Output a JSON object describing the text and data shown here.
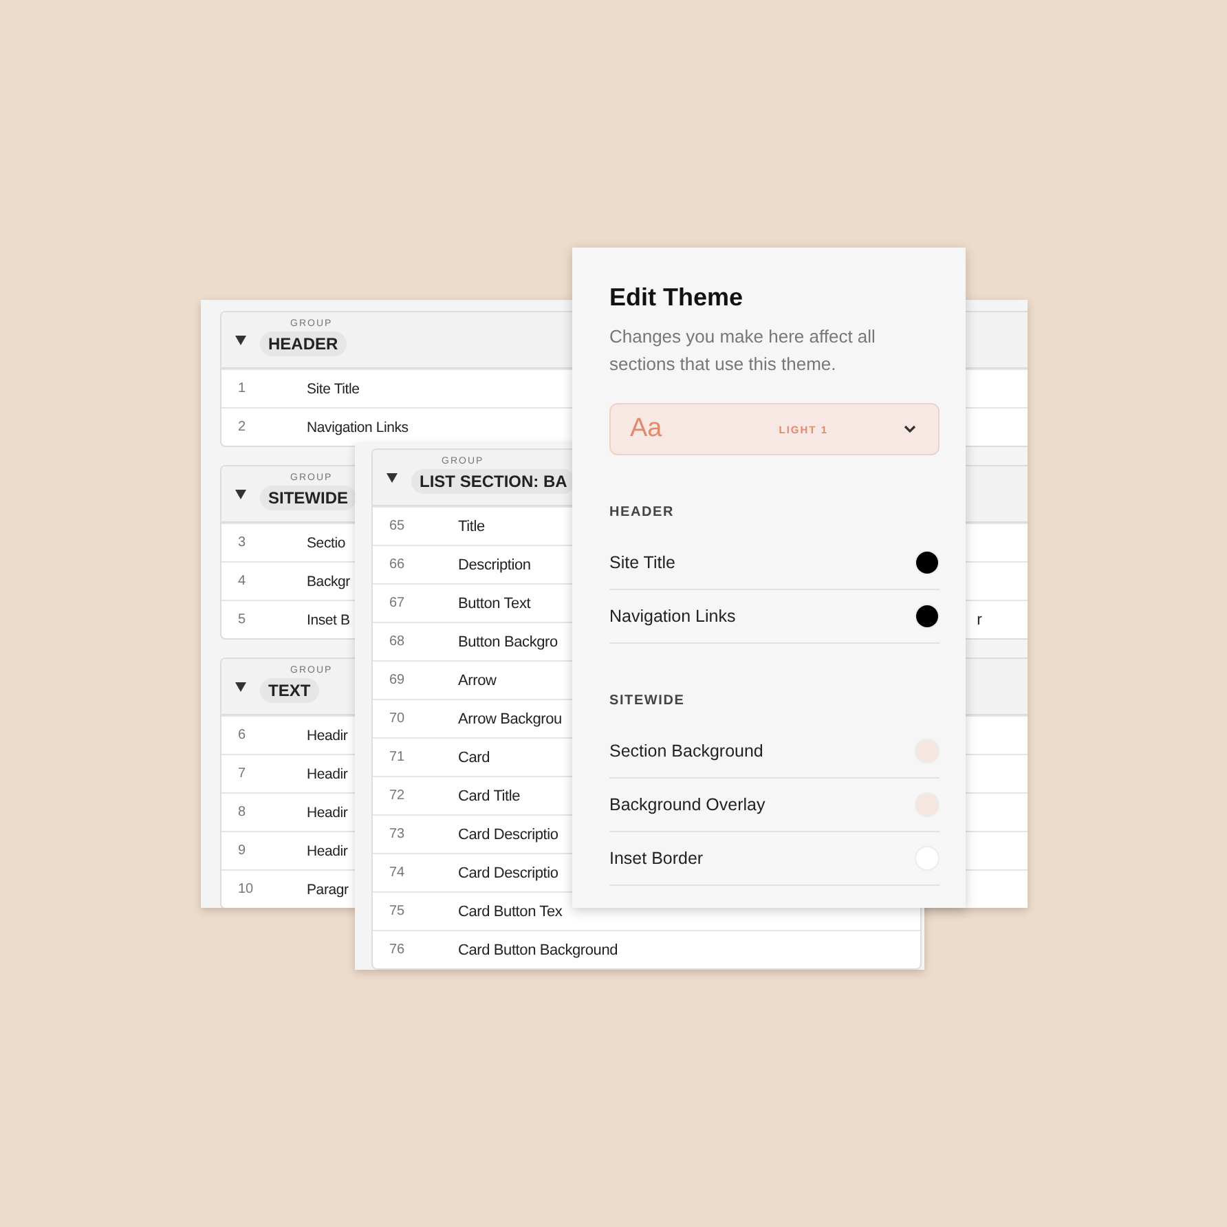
{
  "back_sheet": {
    "groups": [
      {
        "label": "GROUP",
        "name": "HEADER",
        "expanded": true,
        "rows": [
          {
            "number": "1",
            "name": "Site Title"
          },
          {
            "number": "2",
            "name": "Navigation Links"
          }
        ]
      },
      {
        "label": "GROUP",
        "name": "SITEWIDE",
        "expanded": true,
        "rows": [
          {
            "number": "3",
            "name": "Sectio"
          },
          {
            "number": "4",
            "name": "Backgr"
          },
          {
            "number": "5",
            "name": "Inset B",
            "column_3": "r"
          }
        ]
      },
      {
        "label": "GROUP",
        "name": "TEXT",
        "expanded": true,
        "rows": [
          {
            "number": "6",
            "name": "Headir"
          },
          {
            "number": "7",
            "name": "Headir"
          },
          {
            "number": "8",
            "name": "Headir"
          },
          {
            "number": "9",
            "name": "Headir"
          },
          {
            "number": "10",
            "name": "Paragr"
          }
        ]
      }
    ]
  },
  "middle_sheet": {
    "groups": [
      {
        "label": "GROUP",
        "name": "LIST SECTION: BA",
        "expanded": true,
        "rows": [
          {
            "number": "65",
            "name": "Title"
          },
          {
            "number": "66",
            "name": "Description"
          },
          {
            "number": "67",
            "name": "Button Text"
          },
          {
            "number": "68",
            "name": "Button Backgro"
          },
          {
            "number": "69",
            "name": "Arrow"
          },
          {
            "number": "70",
            "name": "Arrow Backgrou"
          },
          {
            "number": "71",
            "name": "Card"
          },
          {
            "number": "72",
            "name": "Card Title"
          },
          {
            "number": "73",
            "name": "Card Descriptio"
          },
          {
            "number": "74",
            "name": "Card Descriptio"
          },
          {
            "number": "75",
            "name": "Card Button Tex"
          },
          {
            "number": "76",
            "name": "Card Button Background"
          }
        ]
      }
    ]
  },
  "edit_theme": {
    "title": "Edit Theme",
    "description": "Changes you make here affect all sections that use this theme.",
    "theme_picker": {
      "sample": "Aa",
      "theme": "LIGHT 1"
    },
    "sections": [
      {
        "heading": "HEADER",
        "items": [
          {
            "name": "Site Title",
            "color": "#000000"
          },
          {
            "name": "Navigation Links",
            "color": "#000000"
          }
        ]
      },
      {
        "heading": "SITEWIDE",
        "items": [
          {
            "name": "Section Background",
            "color": "#f5e6df"
          },
          {
            "name": "Background Overlay",
            "color": "#f5e6df"
          },
          {
            "name": "Inset Border",
            "color": "#ffffff"
          }
        ]
      }
    ]
  }
}
